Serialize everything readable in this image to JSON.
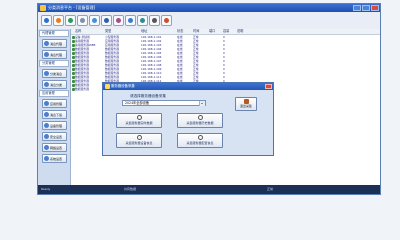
{
  "window": {
    "title": "分类消息平台 - [设备管理]"
  },
  "sidebar": {
    "groups": [
      {
        "header": "代理管理",
        "items": [
          "消息代理",
          "消息代理"
        ]
      },
      {
        "header": "分类管理",
        "items": [
          "分类消息",
          "消息分类"
        ]
      },
      {
        "header": "应用管理",
        "items": [
          "应用管理",
          "消息下载",
          "设备管理",
          "安全设置",
          "网络设置",
          "系统设置"
        ]
      }
    ]
  },
  "grid": {
    "headers": [
      "",
      "名称",
      "类型",
      "地址",
      "状态",
      "时间",
      "端口",
      "容量",
      "说明"
    ],
    "rows": [
      [
        "",
        "设备-测试机",
        "小型服务器",
        "192.168.1.101",
        "在线",
        "正常",
        "",
        "0",
        ""
      ],
      [
        "",
        "备用服务器",
        "应用服务器",
        "192.168.1.102",
        "在线",
        "正常",
        "",
        "0",
        ""
      ],
      [
        "",
        "备用服务器WEB",
        "应用服务器",
        "192.168.1.103",
        "在线",
        "正常",
        "",
        "0",
        ""
      ],
      [
        "",
        "数据服务器",
        "数据服务器",
        "192.168.1.104",
        "在线",
        "正常",
        "",
        "0",
        ""
      ],
      [
        "",
        "数据服务器",
        "数据服务器",
        "192.168.1.105",
        "在线",
        "正常",
        "",
        "0",
        ""
      ],
      [
        "",
        "数据服务器",
        "数据服务器",
        "192.168.1.106",
        "在线",
        "正常",
        "",
        "0",
        ""
      ],
      [
        "",
        "数据服务器",
        "数据服务器",
        "192.168.1.107",
        "在线",
        "正常",
        "",
        "0",
        ""
      ],
      [
        "",
        "数据服务器",
        "数据服务器",
        "192.168.1.108",
        "在线",
        "正常",
        "",
        "0",
        ""
      ],
      [
        "",
        "数据服务器",
        "数据服务器",
        "192.168.1.109",
        "在线",
        "正常",
        "",
        "0",
        ""
      ],
      [
        "",
        "数据服务器",
        "数据服务器",
        "192.168.1.110",
        "在线",
        "正常",
        "",
        "0",
        ""
      ],
      [
        "",
        "数据服务器",
        "数据服务器",
        "192.168.1.111",
        "在线",
        "正常",
        "",
        "0",
        ""
      ],
      [
        "",
        "数据服务器",
        "数据服务器",
        "192.168.1.112",
        "在线",
        "正常",
        "",
        "0",
        ""
      ],
      [
        "",
        "数据服务器",
        "数据服务器",
        "192.168.1.113",
        "在线",
        "正常",
        "",
        "0",
        ""
      ],
      [
        "",
        "数据服务器",
        "数据服务器",
        "192.168.1.114",
        "在线",
        "正常",
        "",
        "0",
        ""
      ]
    ]
  },
  "dialog": {
    "title": "服务器设备采集",
    "label": "请选择服务器设备采集",
    "select_value": "2024年全部设备",
    "exit_label": "退出采集",
    "buttons": [
      "采集服务器实时数据",
      "采集服务器历史数据",
      "采集服务器设备信息",
      "采集服务器配置信息"
    ]
  },
  "statusbar": {
    "left": "Ready",
    "middle": "共有数据",
    "right": "正常"
  },
  "colors": {
    "title_blue": "#2457b5",
    "status_dark": "#1c2f55",
    "row_text": "#2a2a8a"
  }
}
